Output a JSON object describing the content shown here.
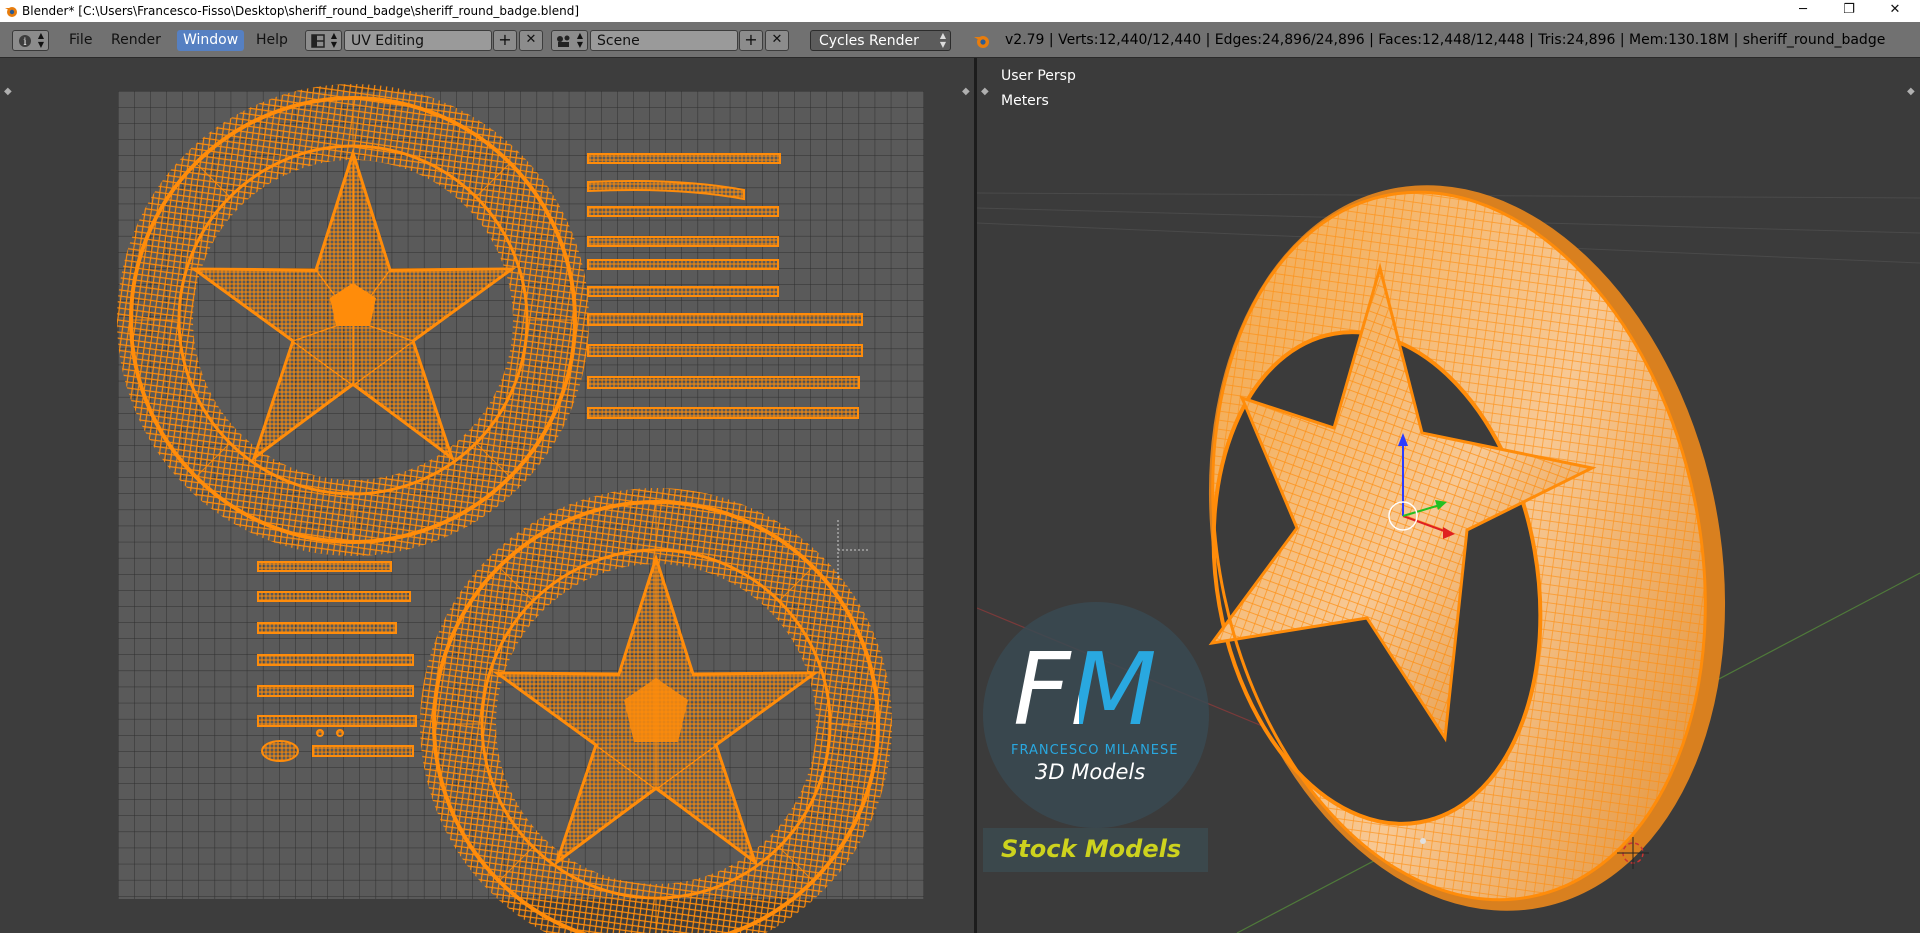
{
  "window": {
    "title": "Blender* [C:\\Users\\Francesco-Fisso\\Desktop\\sheriff_round_badge\\sheriff_round_badge.blend]",
    "minimize_glyph": "─",
    "restore_glyph": "❐",
    "close_glyph": "✕"
  },
  "header": {
    "info_icon": "i",
    "menus": [
      "File",
      "Render",
      "Window",
      "Help"
    ],
    "active_menu": "Window",
    "screen_layout": "UV Editing",
    "scene": "Scene",
    "render_engine": "Cycles Render",
    "add_glyph": "+",
    "remove_glyph": "✕",
    "stats": "v2.79 | Verts:12,440/12,440 | Edges:24,896/24,896 | Faces:12,448/12,448 | Tris:24,896 | Mem:130.18M | sheriff_round_badge"
  },
  "viewport": {
    "view_name": "User Persp",
    "units": "Meters"
  },
  "watermark": {
    "monogram": "FM",
    "author": "FRANCESCO MILANESE",
    "subtitle": "3D Models",
    "tag": "Stock Models"
  },
  "colors": {
    "mesh_orange": "#ff8c0a",
    "active_menu_blue": "#5680c2",
    "fm_blue": "#29a8e0",
    "tag_yellow": "#cdd21e"
  }
}
